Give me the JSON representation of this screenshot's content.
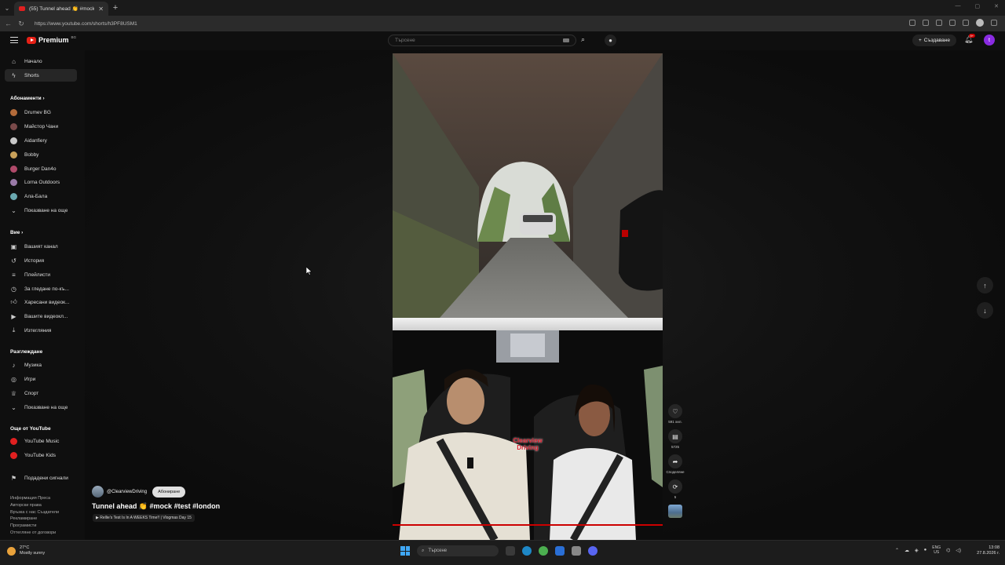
{
  "browser": {
    "tab_title": "(55) Tunnel ahead 👏 #mock",
    "url": "https://www.youtube.com/shorts/h3PF8USM1"
  },
  "header": {
    "logo_text": "Premium",
    "logo_sup": "BG",
    "search_placeholder": "Търсене",
    "create_label": "Създаване",
    "notif_count": "9+",
    "user_initial": "t"
  },
  "sidebar": {
    "main": [
      {
        "label": "Начало",
        "icon": "home-icon"
      },
      {
        "label": "Shorts",
        "icon": "shorts-icon",
        "active": true
      }
    ],
    "subs_heading": "Абонаменти",
    "subscriptions": [
      {
        "label": "Drumev BG",
        "color": "#b36b3a"
      },
      {
        "label": "Майстор Чани",
        "color": "#7a4a4a"
      },
      {
        "label": "Aidanfiery",
        "color": "#c8c8c8"
      },
      {
        "label": "Bobby",
        "color": "#c9a15a"
      },
      {
        "label": "Burger Dan4o",
        "color": "#b04a6a"
      },
      {
        "label": "Lorna Outdoors",
        "color": "#9a7aa8"
      },
      {
        "label": "Ала-Бала",
        "color": "#6aa8b0"
      }
    ],
    "show_more_1": "Показване на още",
    "you_heading": "Вие",
    "you_items": [
      {
        "label": "Вашият канал",
        "icon": "channel-icon"
      },
      {
        "label": "История",
        "icon": "history-icon"
      },
      {
        "label": "Плейлисти",
        "icon": "playlist-icon"
      },
      {
        "label": "За гледане по-къ...",
        "icon": "clock-icon"
      },
      {
        "label": "Харесани видеок...",
        "icon": "like-icon"
      },
      {
        "label": "Вашите видеокл...",
        "icon": "video-icon"
      },
      {
        "label": "Изтегляния",
        "icon": "download-icon"
      }
    ],
    "explore_heading": "Разглеждане",
    "explore_items": [
      {
        "label": "Музика",
        "icon": "music-icon"
      },
      {
        "label": "Игри",
        "icon": "game-icon"
      },
      {
        "label": "Спорт",
        "icon": "trophy-icon"
      }
    ],
    "show_more_2": "Показване на още",
    "more_heading": "Още от YouTube",
    "more_items": [
      {
        "label": "YouTube Music"
      },
      {
        "label": "YouTube Kids"
      }
    ],
    "report_label": "Подадени сигнали",
    "footer": [
      "Информация  Преса",
      "Авторски права",
      "Връзка с нас  Създатели",
      "Рекламиране",
      "Програмисти",
      "Оттегляне от договори"
    ]
  },
  "short": {
    "channel": "@ClearviewDriving",
    "subscribe_label": "Абониране",
    "title": "Tunnel ahead 👏 #mock #test #london",
    "related": "▶ Rellie's Test Is In A WEEKS Time!! | Vlogmas Day 15",
    "watermark_line1": "Clearview",
    "watermark_line2": "Driving",
    "likes": "591 хил.",
    "comments": "5725",
    "share_label": "Споделяне",
    "remix_count": "5"
  },
  "taskbar": {
    "temp": "27°C",
    "weather": "Mostly sunny",
    "search_label": "Търсене",
    "lang_line1": "ENG",
    "lang_line2": "US",
    "time": "13:08",
    "date": "27.8.2026 г."
  }
}
